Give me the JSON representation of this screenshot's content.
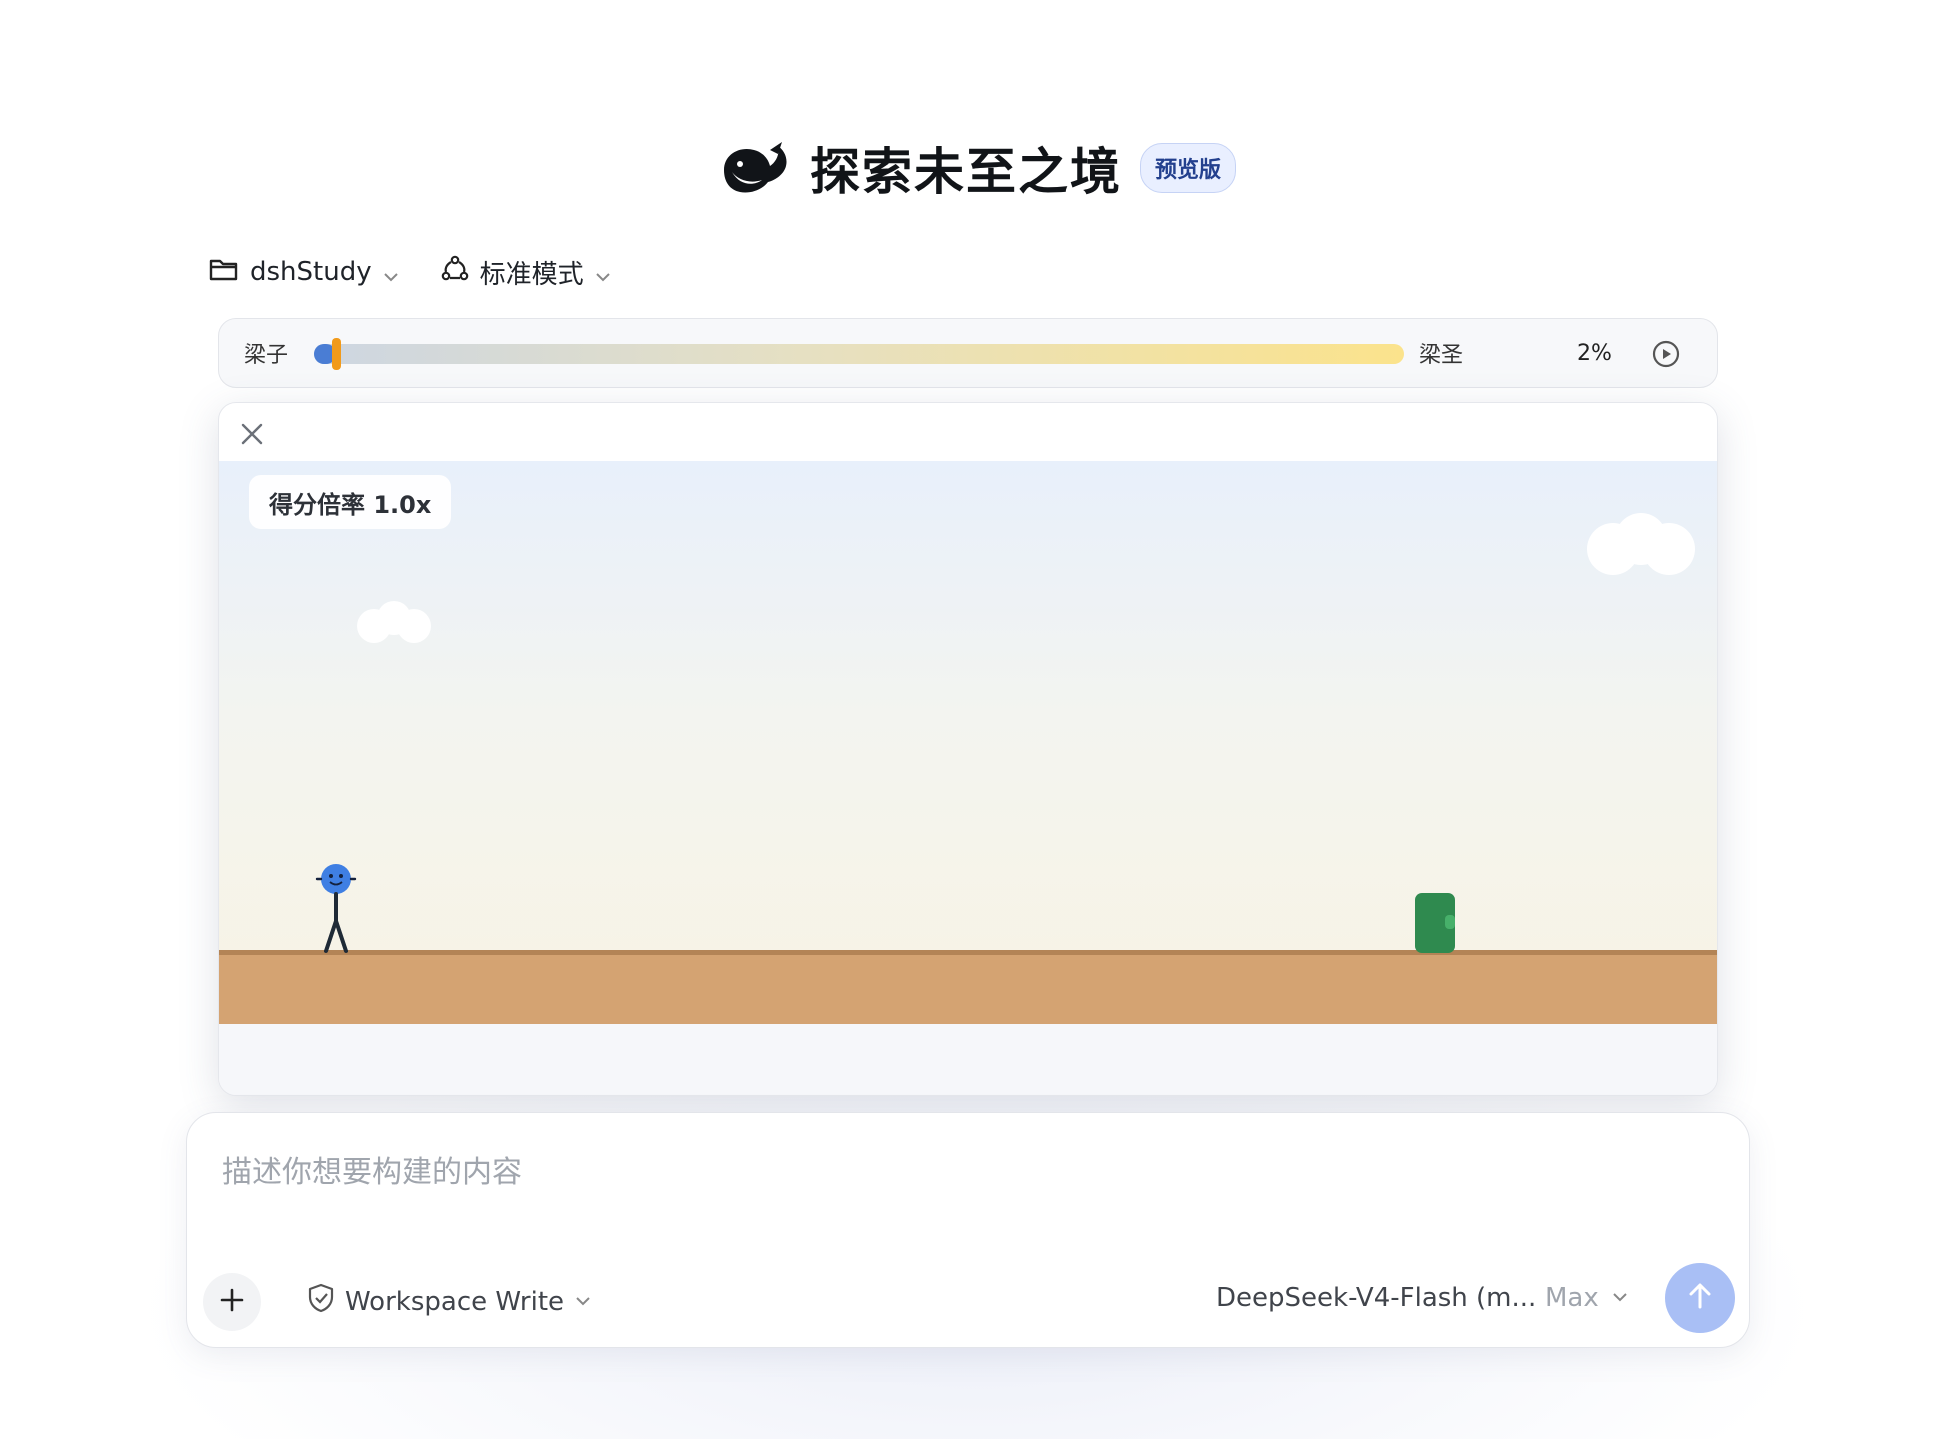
{
  "header": {
    "title": "探索未至之境",
    "badge": "预览版",
    "logo_icon": "whale-logo-icon"
  },
  "toolbar": {
    "project_label": "dshStudy",
    "mode_label": "标准模式"
  },
  "progress": {
    "left_label": "梁子",
    "right_label": "梁圣",
    "percent_label": "2%",
    "percent_value": 2,
    "colors": {
      "fill": "#4a7dd4",
      "thumb": "#f19a1b",
      "track_start": "#cdd6e2",
      "track_end": "#fbe38c"
    }
  },
  "game": {
    "score_label": "得分倍率 1.0x",
    "colors": {
      "ground": "#d4a372",
      "ground_edge": "#b38456",
      "player": "#3f7fe3",
      "obstacle": "#2f8a4f"
    }
  },
  "input": {
    "placeholder": "描述你想要构建的内容",
    "workspace_label": "Workspace Write",
    "model_label": "DeepSeek-V4-Flash (m...",
    "effort_label": "Max",
    "send_color": "#a9bff5"
  }
}
